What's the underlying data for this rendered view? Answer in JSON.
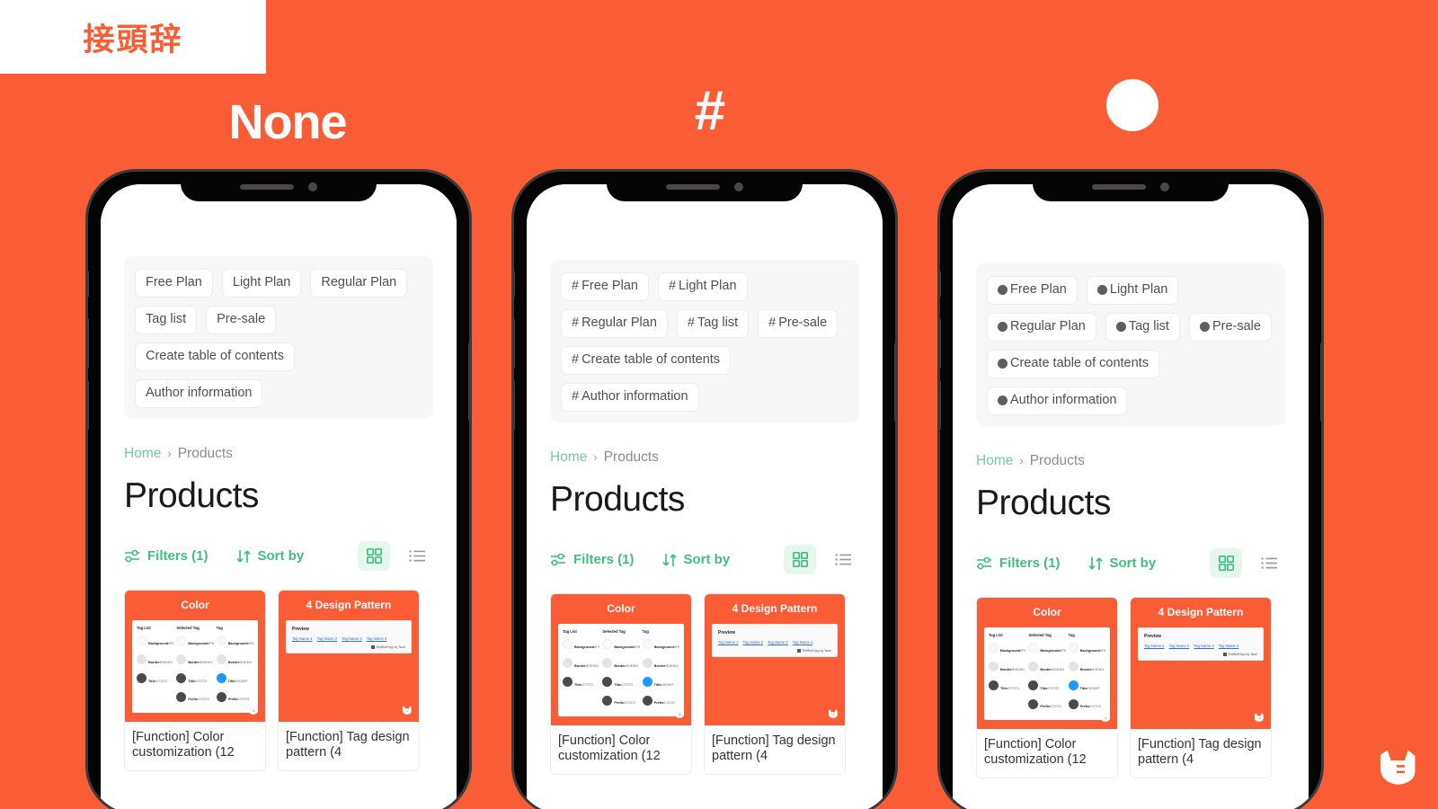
{
  "page": {
    "background_color": "#FA5D35",
    "accent_green": "#3FBF80",
    "banner_text": "接頭辞"
  },
  "columns": [
    {
      "caption": "None",
      "prefix_kind": "none"
    },
    {
      "caption": "#",
      "prefix_kind": "hash"
    },
    {
      "caption": "",
      "prefix_kind": "dot"
    }
  ],
  "tags": {
    "items": [
      "Free Plan",
      "Light Plan",
      "Regular Plan",
      "Tag list",
      "Pre-sale",
      "Create table of contents",
      "Author information"
    ],
    "hash_prefix": "#"
  },
  "breadcrumb": {
    "home": "Home",
    "separator": "›",
    "current": "Products"
  },
  "title": "Products",
  "toolbar": {
    "filters_label": "Filters (1)",
    "sort_label": "Sort by",
    "filter_icon": "sliders-icon",
    "sort_icon": "arrows-up-down-icon",
    "grid_icon": "grid-view-icon",
    "list_icon": "list-view-icon",
    "active_view": "grid",
    "active_bg": "#E6F7EE"
  },
  "cards": [
    {
      "thumb_title": "Color",
      "caption": "[Function] Color customization (12",
      "type": "swatches",
      "swatch_columns": [
        {
          "head": "Tag List",
          "rows": [
            {
              "name": "Background",
              "hex": "#F9F9F9",
              "color": "#F9F9F9"
            },
            {
              "name": "Border",
              "hex": "#E4E4E4",
              "color": "#E4E4E4"
            },
            {
              "name": "Title",
              "hex": "#727272",
              "color": "#4A4A4A"
            }
          ]
        },
        {
          "head": "Selected Tag",
          "rows": [
            {
              "name": "Background",
              "hex": "#F9F9F9",
              "color": "#FAFAFA"
            },
            {
              "name": "Border",
              "hex": "#E4E4E4",
              "color": "#E4E4E4"
            },
            {
              "name": "Title",
              "hex": "#727272",
              "color": "#4A4A4A"
            },
            {
              "name": "Prefix",
              "hex": "#727272",
              "color": "#4A4A4A"
            }
          ]
        },
        {
          "head": "Tag",
          "rows": [
            {
              "name": "Background",
              "hex": "#F9F9F9",
              "color": "#F7F7F7"
            },
            {
              "name": "Border",
              "hex": "#E4E4E4",
              "color": "#E4E4E4"
            },
            {
              "name": "Title",
              "hex": "#1E9AFF",
              "color": "#1E9AFF"
            },
            {
              "name": "Prefix",
              "hex": "#727272",
              "color": "#4A4A4A"
            }
          ]
        }
      ]
    },
    {
      "thumb_title": "4 Design Pattern",
      "caption": "[Function] Tag design pattern (4",
      "type": "preview",
      "preview": {
        "label": "Preview",
        "tags": [
          "Tag Name 1",
          "Tag Name 2",
          "Tag Name 3",
          "Tag Name 4"
        ],
        "footer": "RuffRuff App by Tsuni"
      }
    }
  ],
  "mascot": {
    "name": "dog-head-logo",
    "color": "#FFFFFF"
  }
}
